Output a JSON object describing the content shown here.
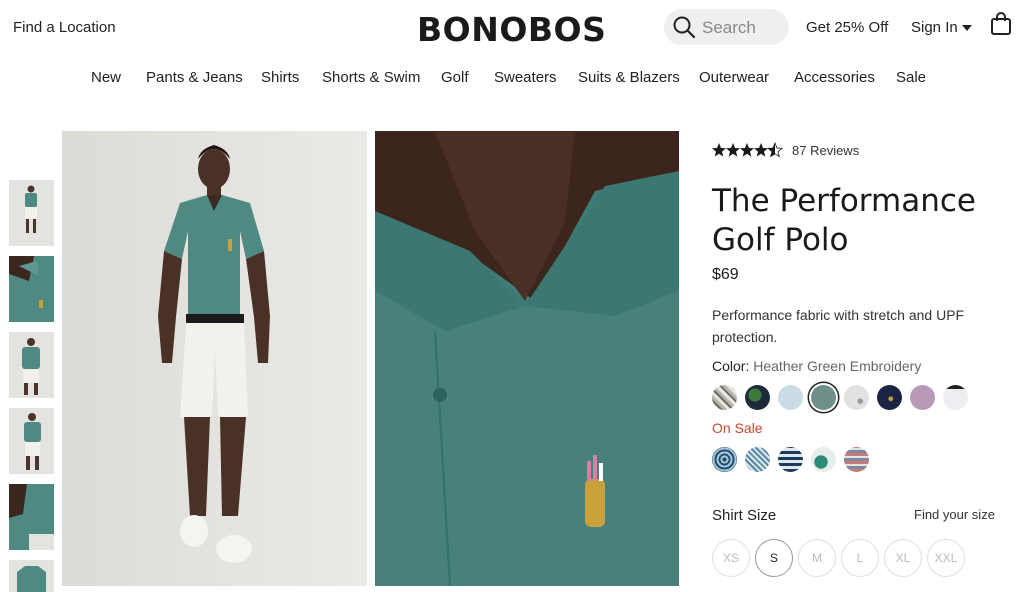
{
  "header": {
    "find_location": "Find a Location",
    "logo": "BONOBOS",
    "search_placeholder": "Search",
    "promo": "Get 25% Off",
    "sign_in": "Sign In"
  },
  "nav": {
    "items": [
      "New",
      "Pants & Jeans",
      "Shirts",
      "Shorts & Swim",
      "Golf",
      "Sweaters",
      "Suits & Blazers",
      "Outerwear",
      "Accessories",
      "Sale"
    ]
  },
  "product": {
    "rating": 4.5,
    "reviews": "87 Reviews",
    "title": "The Performance Golf Polo",
    "price": "$69",
    "description": "Performance fabric with stretch and UPF protection.",
    "color_label": "Color:",
    "color_value": "Heather Green Embroidery",
    "sale_label": "On Sale",
    "size_label": "Shirt Size",
    "find_size": "Find your size",
    "sizes": [
      "XS",
      "S",
      "M",
      "L",
      "XL",
      "XXL"
    ],
    "selected_size": "S"
  },
  "colors": {
    "accent_sale": "#c9462c",
    "shirt_green": "#4f8a82",
    "shorts_white": "#f2f1ec"
  },
  "icons": [
    "search-icon",
    "caret-down-icon",
    "bag-icon",
    "star-icon"
  ]
}
